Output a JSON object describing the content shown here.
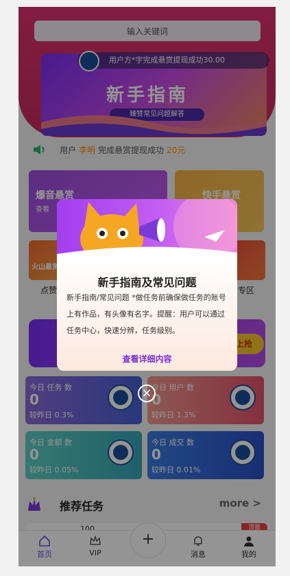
{
  "search": {
    "placeholder": "输入关键词"
  },
  "banner": {
    "title": "新手指南",
    "subtitle": "臻赞常见问题解答",
    "ticker": "用户方*宇完成悬赏提现成功30.00"
  },
  "notice": {
    "prefix": "用户",
    "name": "李明",
    "middle": "完成悬赏提现成功",
    "amount": "20元"
  },
  "categories": [
    {
      "title": "爆音悬赏",
      "sub": "查看"
    },
    {
      "title": "快手悬赏"
    },
    {
      "title": "火山悬赏"
    },
    {
      "label_left": "点赞"
    },
    {
      "label_right": "专区"
    }
  ],
  "promo": {
    "button": "上抢"
  },
  "stats": [
    {
      "label": "今日 任务 数",
      "value": "0",
      "compare": "较昨日 0.3%"
    },
    {
      "label": "今日 用户 数",
      "value": "0",
      "compare": "较昨日 1.3%"
    },
    {
      "label": "今日 金额 数",
      "value": "0",
      "compare": "较昨日 0.05%"
    },
    {
      "label": "今日 成交 数",
      "value": "0",
      "compare": "较昨日 0.01%"
    }
  ],
  "recommend": {
    "title": "推荐任务",
    "more": "more >",
    "badge": "顶置",
    "preview": "100"
  },
  "tabs": [
    {
      "label": "首页",
      "icon": "home-icon",
      "active": true
    },
    {
      "label": "VIP",
      "icon": "crown-icon"
    },
    {
      "label": "+",
      "icon": "plus-icon"
    },
    {
      "label": "消息",
      "icon": "bell-icon"
    },
    {
      "label": "我的",
      "icon": "user-icon"
    }
  ],
  "modal": {
    "title": "新手指南及常见问题",
    "text": "新手指南/常见问题 *做任务前确保做任务的账号上有作品，有头像有名字。提醒：用户可以通过任务中心，快速分辨，任务级别。",
    "link": "查看详细内容",
    "close": "×"
  },
  "colors": {
    "accent": "#6a4ae0",
    "brand": "#e0336f",
    "highlight": "#ff8a00"
  }
}
